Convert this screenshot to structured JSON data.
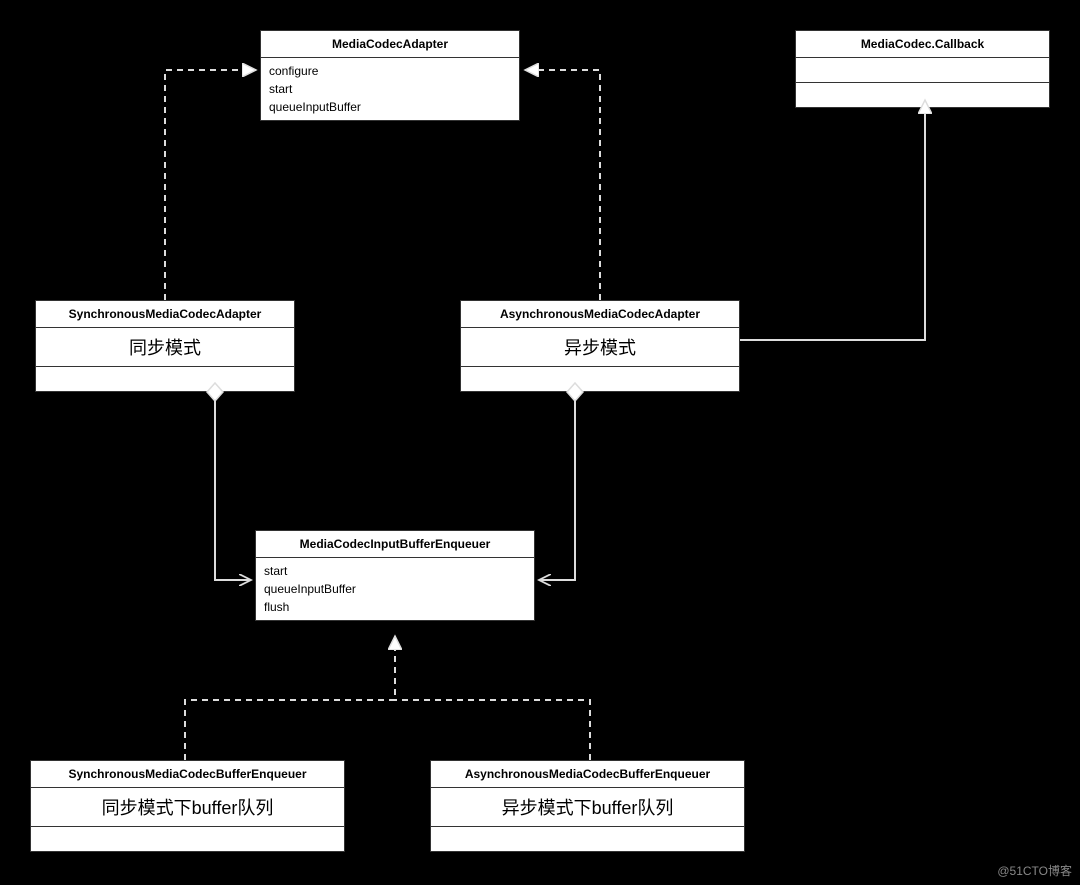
{
  "watermark": "@51CTO博客",
  "classes": {
    "mediaCodecAdapter": {
      "title": "MediaCodecAdapter",
      "ops": [
        "configure",
        "start",
        "queueInputBuffer"
      ]
    },
    "mediaCodecCallback": {
      "title": "MediaCodec.Callback"
    },
    "syncAdapter": {
      "title": "SynchronousMediaCodecAdapter",
      "subtitle": "同步模式"
    },
    "asyncAdapter": {
      "title": "AsynchronousMediaCodecAdapter",
      "subtitle": "异步模式"
    },
    "enqueuer": {
      "title": "MediaCodecInputBufferEnqueuer",
      "ops": [
        "start",
        "queueInputBuffer",
        "flush"
      ]
    },
    "syncBuffer": {
      "title": "SynchronousMediaCodecBufferEnqueuer",
      "subtitle": "同步模式下buffer队列"
    },
    "asyncBuffer": {
      "title": "AsynchronousMediaCodecBufferEnqueuer",
      "subtitle": "异步模式下buffer队列"
    }
  },
  "relations": [
    {
      "from": "syncAdapter",
      "to": "mediaCodecAdapter",
      "type": "realization"
    },
    {
      "from": "asyncAdapter",
      "to": "mediaCodecAdapter",
      "type": "realization"
    },
    {
      "from": "asyncAdapter",
      "to": "mediaCodecCallback",
      "type": "generalization"
    },
    {
      "from": "syncAdapter",
      "to": "enqueuer",
      "type": "aggregation"
    },
    {
      "from": "asyncAdapter",
      "to": "enqueuer",
      "type": "aggregation"
    },
    {
      "from": "syncBuffer",
      "to": "enqueuer",
      "type": "realization"
    },
    {
      "from": "asyncBuffer",
      "to": "enqueuer",
      "type": "realization"
    }
  ]
}
